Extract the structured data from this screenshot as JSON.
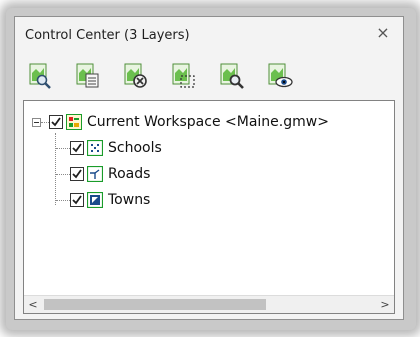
{
  "panel": {
    "title": "Control Center (3 Layers)",
    "close_glyph": "×"
  },
  "toolbar": {
    "buttons": [
      {
        "icon": "layer-search-icon"
      },
      {
        "icon": "layer-list-icon"
      },
      {
        "icon": "layer-remove-icon"
      },
      {
        "icon": "layer-select-icon"
      },
      {
        "icon": "layer-zoom-icon"
      },
      {
        "icon": "layer-view-icon"
      }
    ]
  },
  "tree": {
    "workspace": {
      "label": "Current Workspace <Maine.gmw>",
      "checked": true,
      "icon": "workspace-icon"
    },
    "layers": [
      {
        "label": "Schools",
        "checked": true,
        "icon": "point-layer-icon"
      },
      {
        "label": "Roads",
        "checked": true,
        "icon": "line-layer-icon"
      },
      {
        "label": "Towns",
        "checked": true,
        "icon": "polygon-layer-icon"
      }
    ]
  },
  "scrollbar": {
    "left_glyph": "<",
    "right_glyph": ">"
  },
  "colors": {
    "panel_bg": "#f3f3f3",
    "layer_icon_green": "#1a9c2a",
    "check": "#1e1e1e"
  }
}
